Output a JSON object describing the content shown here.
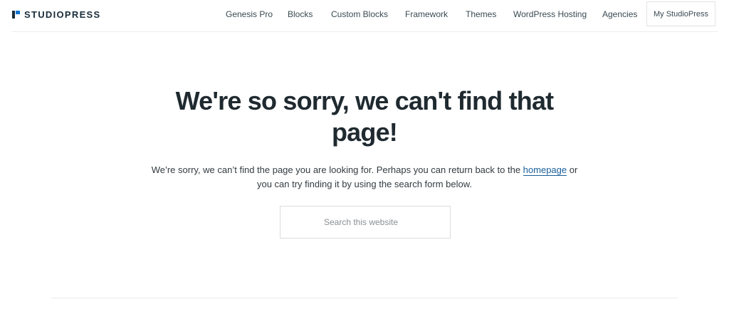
{
  "brand": {
    "name": "STUDIOPRESS",
    "colors": {
      "dark": "#1a2d3a",
      "accent": "#0a73d1"
    }
  },
  "nav": {
    "items": [
      {
        "label": "Genesis Pro"
      },
      {
        "label": "Blocks"
      },
      {
        "label": "Custom Blocks"
      },
      {
        "label": "Framework"
      },
      {
        "label": "Themes"
      },
      {
        "label": "WordPress Hosting"
      },
      {
        "label": "Agencies"
      }
    ],
    "account_label": "My StudioPress"
  },
  "error": {
    "heading": "We're so sorry, we can't find that page!",
    "message_before": "We’re sorry, we can’t find the page you are looking for. Perhaps you can return back to the ",
    "link_text": "homepage",
    "message_after": " or you can try finding it by using the search form below."
  },
  "search": {
    "placeholder": "Search this website",
    "value": ""
  }
}
